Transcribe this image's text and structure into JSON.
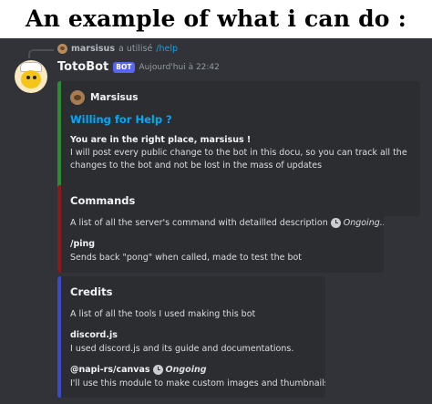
{
  "caption": "An example of what i can do :",
  "reply": {
    "user": "marsisus",
    "action": "a utilisé",
    "command": "/help"
  },
  "message": {
    "author": "TotoBot",
    "tag": "BOT",
    "timestamp": "Aujourd'hui à 22:42"
  },
  "embeds": [
    {
      "author": "Marsisus",
      "title": "Willing for Help ?",
      "bold_line": "You are in the right place, marsisus !",
      "body": "I will post every public change to the bot in this docu, so you can track all the changes to the bot and not be lost in the mass of updates"
    },
    {
      "title": "Commands",
      "description": "A list of all the server's command with detailled description",
      "description_status": "Ongoing...",
      "fields": [
        {
          "name": "/ping",
          "value": "Sends back \"pong\" when called, made to test the bot"
        }
      ]
    },
    {
      "title": "Credits",
      "description": "A list of all the tools I used making this bot",
      "fields": [
        {
          "name": "discord.js",
          "value": "I used discord.js and its guide and documentations."
        },
        {
          "name": "@napi-rs/canvas",
          "status": "Ongoing",
          "value": "I'll use this module to make custom images and thumbnails."
        }
      ]
    }
  ],
  "icons": {
    "reply_avatar": "user-avatar-icon",
    "bot_avatar": "bot-avatar-icon",
    "author_icon": "author-avatar-icon",
    "status_icon": "clock-icon"
  },
  "colors": {
    "background": "#313338",
    "embed_background": "#2b2d31",
    "link": "#00a8fc",
    "bot_tag": "#5865f2",
    "embed1_border": "#2e8b34",
    "embed2_border": "#8b1a1a",
    "embed3_border": "#3b4bc8"
  }
}
